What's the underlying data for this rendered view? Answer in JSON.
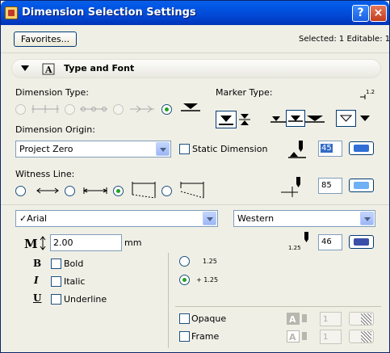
{
  "window": {
    "title": "Dimension Selection Settings",
    "help_glyph": "?",
    "close_glyph": "×"
  },
  "header": {
    "favorites_label": "Favorites...",
    "selection_status": "Selected: 1 Editable: 1"
  },
  "section": {
    "title": "Type and Font"
  },
  "dimension_type": {
    "label": "Dimension Type:",
    "selected_index": 3
  },
  "marker_type": {
    "label": "Marker Type:",
    "marker_size": "1.2"
  },
  "dimension_origin": {
    "label": "Dimension Origin:",
    "value": "Project Zero",
    "static_dimension_label": "Static Dimension",
    "static_dimension_checked": false,
    "pen_number": "45",
    "pen_color": "#2f6fd6"
  },
  "witness_line": {
    "label": "Witness Line:",
    "selected_index": 2,
    "pen_number": "85",
    "pen_color": "#6fb0f5"
  },
  "font": {
    "family": "✓Arial",
    "encoding": "Western",
    "size_value": "2.00",
    "size_unit": "mm",
    "text_pen_marker": "1.25",
    "pen_number": "46",
    "pen_color": "#3b4fa8",
    "bold_label": "Bold",
    "italic_label": "Italic",
    "underline_label": "Underline",
    "bold_glyph": "B",
    "italic_glyph": "I",
    "underline_glyph": "U"
  },
  "text_position": {
    "option1": "1.25",
    "option2": "+ 1.25",
    "selected_index": 1
  },
  "fill": {
    "opaque_label": "Opaque",
    "frame_label": "Frame",
    "opaque_pen": "1",
    "frame_pen": "1"
  }
}
